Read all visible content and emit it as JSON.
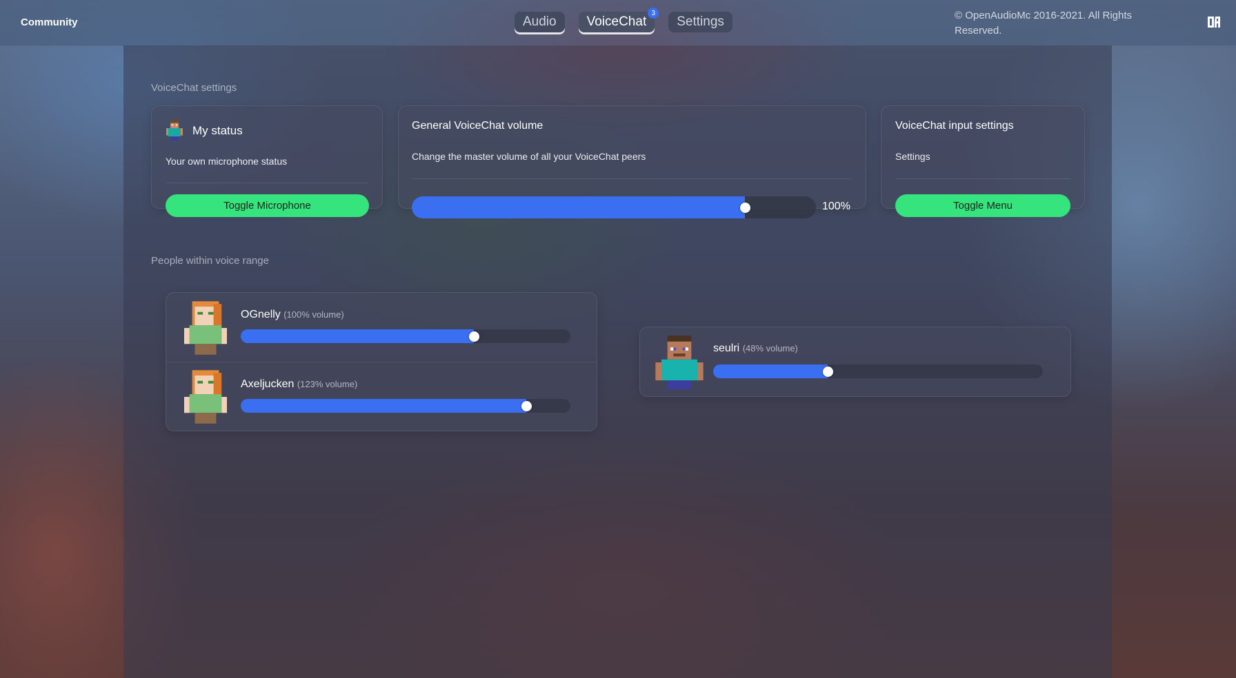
{
  "header": {
    "brand": "Community",
    "tabs": [
      {
        "label": "Audio"
      },
      {
        "label": "VoiceChat",
        "badge": "3"
      },
      {
        "label": "Settings"
      }
    ],
    "copyright": "© OpenAudioMc 2016-2021. All Rights Reserved.",
    "logo_icon": "openaudiomc-logo-icon"
  },
  "voicechat_settings": {
    "section_title": "VoiceChat settings",
    "my_status": {
      "title": "My status",
      "description": "Your own microphone status",
      "button": "Toggle Microphone"
    },
    "general_volume": {
      "title": "General VoiceChat volume",
      "description": "Change the master volume of all your VoiceChat peers",
      "value": 100,
      "value_label": "100%"
    },
    "input_settings": {
      "title": "VoiceChat input settings",
      "description": "Settings",
      "button": "Toggle Menu"
    }
  },
  "peers_section": {
    "title": "People within voice range",
    "groups": [
      {
        "peers": [
          {
            "name": "OGnelly",
            "volume_label": "(100% volume)",
            "slider": 0.71,
            "skin": "alex"
          },
          {
            "name": "Axeljucken",
            "volume_label": "(123% volume)",
            "slider": 0.87,
            "skin": "alex"
          }
        ]
      },
      {
        "peers": [
          {
            "name": "seulri",
            "volume_label": "(48% volume)",
            "slider": 0.35,
            "skin": "steve"
          }
        ]
      }
    ]
  },
  "colors": {
    "accent_blue": "#3a6ff2",
    "accent_green": "#36e47e"
  }
}
